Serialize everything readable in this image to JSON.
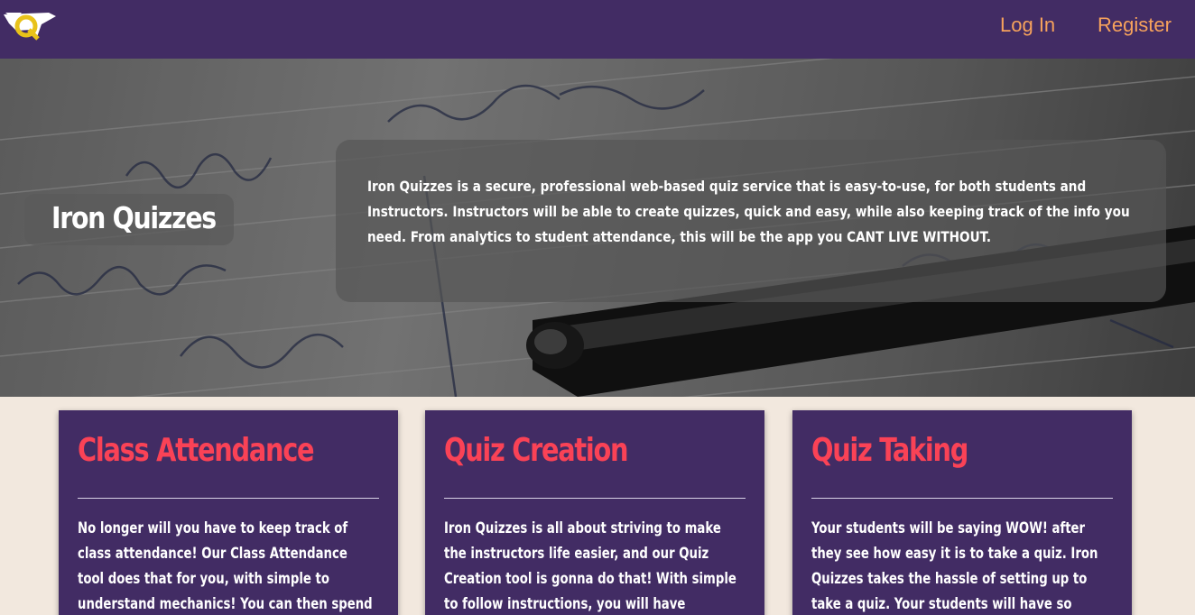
{
  "header": {
    "logo_icon": "iron-quizzes-logo-icon",
    "logo_letter": "Q",
    "login_label": "Log In",
    "register_label": "Register"
  },
  "hero": {
    "title": "Iron Quizzes",
    "description": "Iron Quizzes is a secure, professional web-based quiz service that is easy-to-use, for both students and Instructors. Instructors will be able to create quizzes, quick and easy, while also keeping track of the info you need. From analytics to student attendance, this will be the app you CANT LIVE WITHOUT."
  },
  "features": [
    {
      "title": "Class Attendance",
      "text": "No longer will you have to keep track of class attendance! Our Class Attendance tool does that for you, with simple to understand mechanics! You can then spend the time that"
    },
    {
      "title": "Quiz Creation",
      "text": "Iron Quizzes is all about striving to make the instructors life easier, and our Quiz Creation tool is gonna do that! With simple to follow instructions, you will have students answering"
    },
    {
      "title": "Quiz Taking",
      "text": "Your students will be saying WOW! after they see how easy it is to take a quiz. Iron Quizzes takes the hassle of setting up to take a quiz. Your students will have so much free time,"
    }
  ],
  "colors": {
    "nav_background": "#422c64",
    "nav_link": "#f6a25c",
    "card_title": "#fa4256",
    "page_background": "#f2e8de"
  }
}
